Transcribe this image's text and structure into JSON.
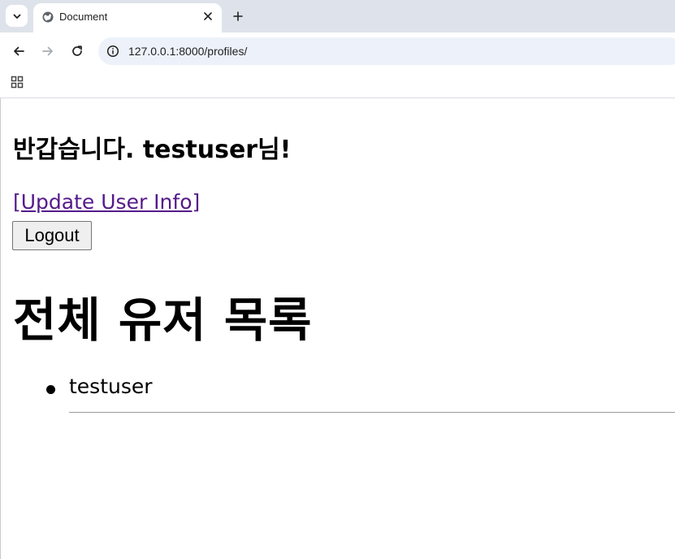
{
  "browser": {
    "tab_title": "Document",
    "url": "127.0.0.1:8000/profiles/",
    "icons": {
      "tab_search": "chevron-down-icon",
      "favicon": "globe-icon",
      "tab_close": "close-icon",
      "new_tab": "plus-icon",
      "back": "arrow-left-icon",
      "forward": "arrow-right-icon",
      "reload": "reload-icon",
      "site_info": "info-icon",
      "apps": "apps-grid-icon"
    }
  },
  "page": {
    "greeting": "반갑습니다. testuser님!",
    "update_link": "[Update User Info]",
    "logout_button": "Logout",
    "users_heading": "전체 유저 목록",
    "users": [
      {
        "username": "testuser"
      }
    ]
  },
  "colors": {
    "tabstrip": "#dee3eb",
    "omnibox": "#edf2fa",
    "visited_link": "#551a8b"
  }
}
